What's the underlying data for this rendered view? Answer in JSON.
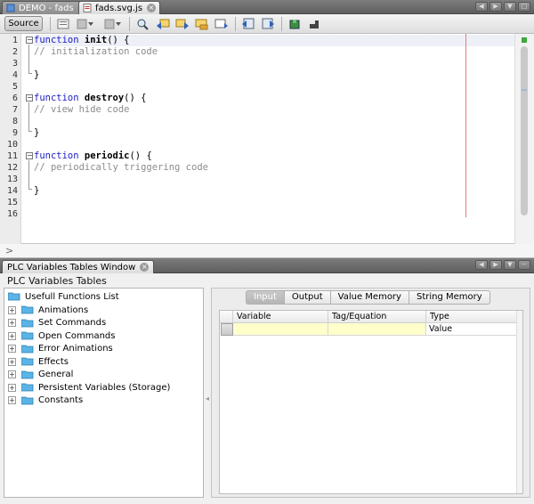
{
  "editor_tabs": [
    {
      "label": "DEMO - fads",
      "active": false
    },
    {
      "label": "fads.svg.js",
      "active": true
    }
  ],
  "toolbar": {
    "source_label": "Source",
    "icons": [
      "history-icon",
      "dropdown-icon",
      "navigate-icon",
      "dropdown-icon",
      "find-icon",
      "find-previous-icon",
      "find-next-icon",
      "toggle-highlight-icon",
      "find-selection-icon",
      "shift-left-icon",
      "shift-right-icon",
      "start-macro-icon",
      "stop-macro-icon"
    ]
  },
  "code": {
    "line_numbers": [
      "1",
      "2",
      "3",
      "4",
      "5",
      "6",
      "7",
      "8",
      "9",
      "10",
      "11",
      "12",
      "13",
      "14",
      "15",
      "16"
    ],
    "functions": [
      {
        "keyword": "function",
        "name": "init",
        "signature": "() {",
        "comment": "// initialization code",
        "close": "}"
      },
      {
        "keyword": "function",
        "name": "destroy",
        "signature": "() {",
        "comment": "// view hide code",
        "close": "}"
      },
      {
        "keyword": "function",
        "name": "periodic",
        "signature": "() {",
        "comment": "// periodically triggering code",
        "close": "}"
      }
    ]
  },
  "cmdline": {
    "prompt": ">"
  },
  "panel": {
    "tab_label": "PLC Variables Tables Window",
    "title": "PLC Variables Tables",
    "tree": {
      "root": "Usefull Functions List",
      "items": [
        "Animations",
        "Set Commands",
        "Open Commands",
        "Error Animations",
        "Effects",
        "General",
        "Persistent Variables (Storage)",
        "Constants"
      ]
    },
    "tabs": [
      "Input",
      "Output",
      "Value Memory",
      "String Memory"
    ],
    "table": {
      "columns": [
        "Variable",
        "Tag/Equation",
        "Type"
      ],
      "rows": [
        [
          "",
          "",
          "Value"
        ]
      ]
    }
  },
  "colors": {
    "keyword": "#1c1cc4",
    "comment": "#8c8c8c",
    "folder": "#5ab4e6",
    "row_highlight": "#ffffcc"
  }
}
